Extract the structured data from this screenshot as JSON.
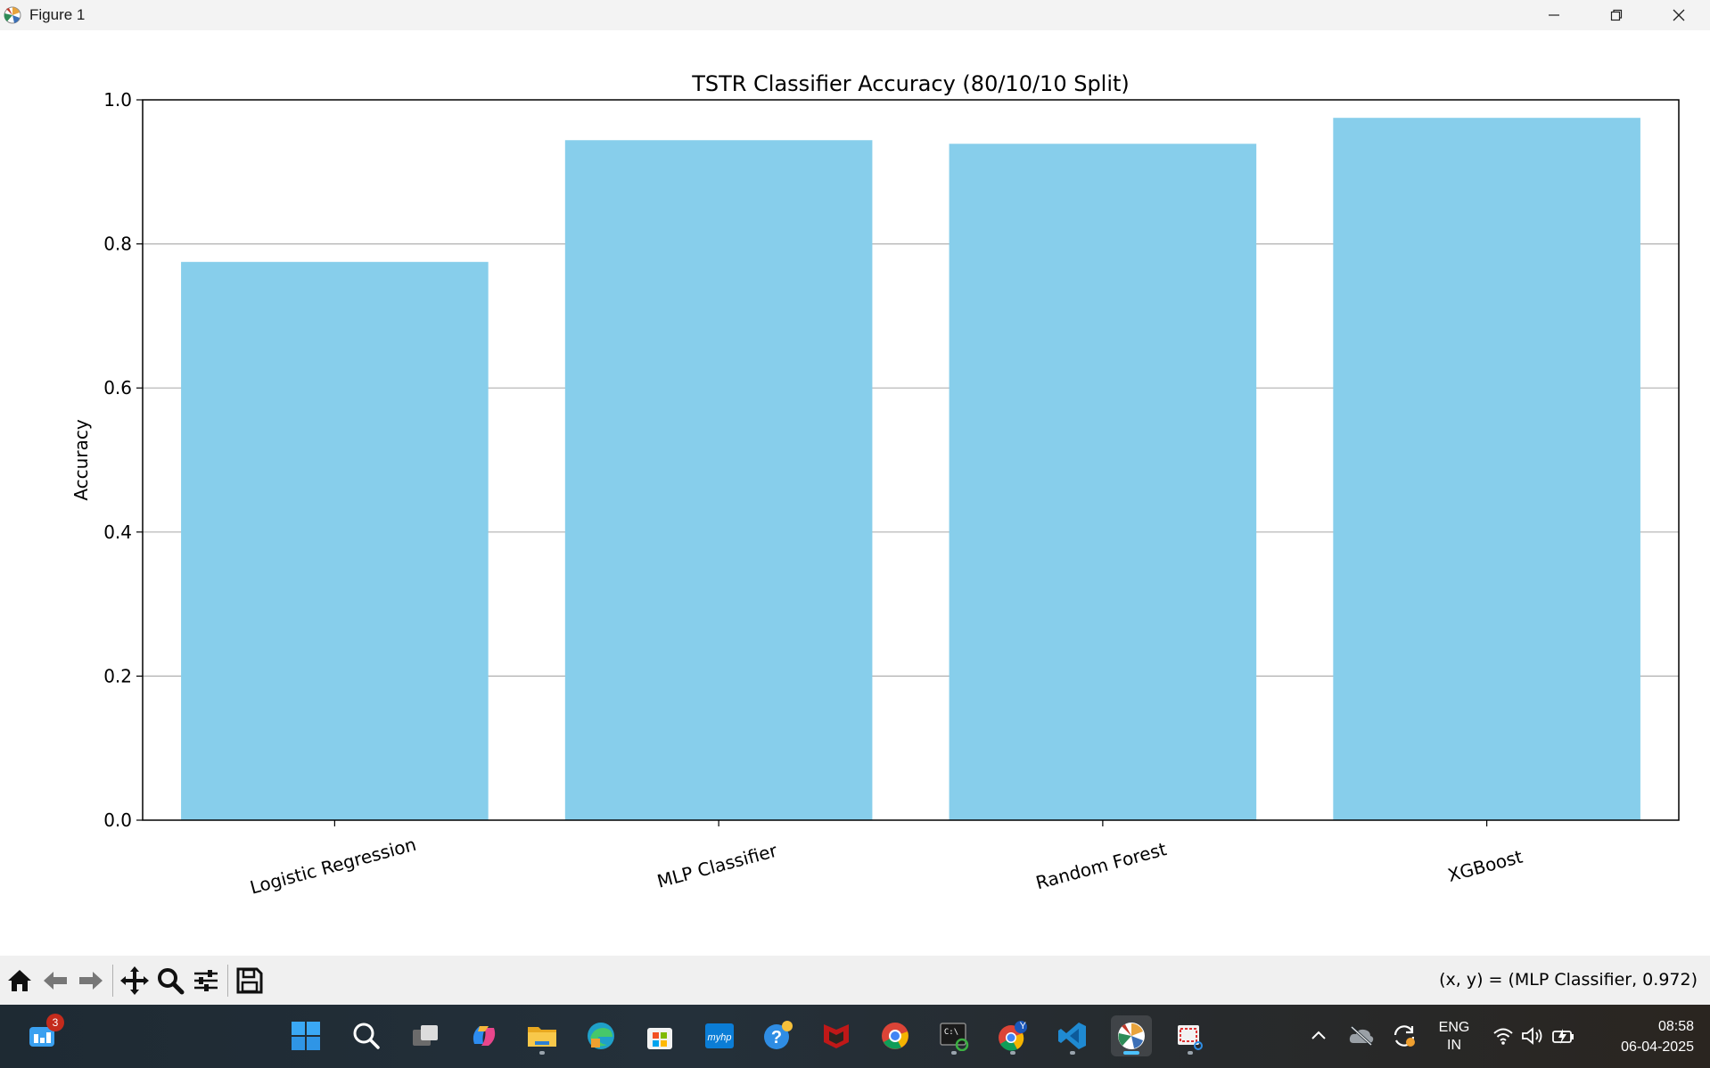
{
  "window": {
    "title": "Figure 1"
  },
  "chart_data": {
    "type": "bar",
    "title": "TSTR Classifier Accuracy (80/10/10 Split)",
    "xlabel": "",
    "ylabel": "Accuracy",
    "categories": [
      "Logistic Regression",
      "MLP Classifier",
      "Random Forest",
      "XGBoost"
    ],
    "values": [
      0.775,
      0.944,
      0.939,
      0.975
    ],
    "ylim": [
      0,
      1.0
    ],
    "yticks": [
      "0.0",
      "0.2",
      "0.4",
      "0.6",
      "0.8",
      "1.0"
    ],
    "grid": "y",
    "bar_color": "#87ceeb",
    "xtick_rotation": 15
  },
  "toolbar": {
    "buttons": [
      "home-icon",
      "back-icon",
      "forward-icon",
      "pan-icon",
      "zoom-icon",
      "configure-icon",
      "save-icon"
    ],
    "coords_text": "(x, y) = (MLP Classifier, 0.972)"
  },
  "taskbar": {
    "notification_badge": "3",
    "language_line1": "ENG",
    "language_line2": "IN",
    "time": "08:58",
    "date": "06-04-2025",
    "profile_badge": "Y"
  }
}
